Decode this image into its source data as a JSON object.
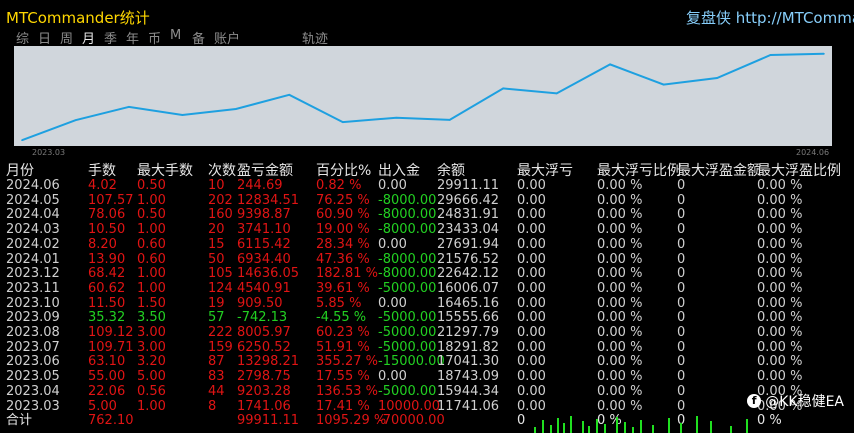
{
  "app": {
    "title": "MTCommander统计",
    "brand": "复盘侠 http://MTCommander"
  },
  "tabs": [
    {
      "label": "综",
      "active": false
    },
    {
      "label": "日",
      "active": false
    },
    {
      "label": "周",
      "active": false
    },
    {
      "label": "月",
      "active": true
    },
    {
      "label": "季",
      "active": false
    },
    {
      "label": "年",
      "active": false
    },
    {
      "label": "币",
      "active": false
    },
    {
      "label": "M",
      "active": false
    },
    {
      "label": "备",
      "active": false
    },
    {
      "label": "账户",
      "active": false
    },
    {
      "label": "轨迹",
      "active": false
    }
  ],
  "chart_data": {
    "type": "line",
    "x_start_label": "2023.03",
    "x_end_label": "2024.06",
    "series_color": "#1ea0e0",
    "grid": false,
    "x": [
      "2023.03",
      "2023.04",
      "2023.05",
      "2023.06",
      "2023.07",
      "2023.08",
      "2023.09",
      "2023.10",
      "2023.11",
      "2023.12",
      "2024.01",
      "2024.02",
      "2024.03",
      "2024.04",
      "2024.05",
      "2024.06"
    ],
    "values": [
      11741.06,
      15944.34,
      18743.09,
      17041.3,
      18291.82,
      21297.79,
      15555.66,
      16465.16,
      16006.07,
      22642.12,
      21576.52,
      27691.94,
      23433.04,
      24831.91,
      29666.42,
      29911.11
    ]
  },
  "table": {
    "headers": [
      "月份",
      "手数",
      "最大手数",
      "次数",
      "盈亏金额",
      "百分比%",
      "出入金",
      "余额",
      "最大浮亏",
      "最大浮亏比例",
      "最大浮盈金额",
      "最大浮盈比例"
    ],
    "colors": {
      "negative": "#e01414",
      "positive": "#22d022",
      "neutral": "#d0d0d0",
      "header": "#e6e6e6"
    },
    "rows": [
      {
        "month": "2024.06",
        "lots": "4.02",
        "maxlots": "0.50",
        "count": "10",
        "pnl": "244.69",
        "pct": "0.82 %",
        "flow": "0.00",
        "balance": "29911.11",
        "maxdd": "0.00",
        "maxddpct": "0.00 %",
        "maxfloat": "0",
        "maxfloatpct": "0.00 %",
        "sign": "negative"
      },
      {
        "month": "2024.05",
        "lots": "107.57",
        "maxlots": "1.00",
        "count": "202",
        "pnl": "12834.51",
        "pct": "76.25 %",
        "flow": "-8000.00",
        "balance": "29666.42",
        "maxdd": "0.00",
        "maxddpct": "0.00 %",
        "maxfloat": "0",
        "maxfloatpct": "0.00 %",
        "sign": "negative"
      },
      {
        "month": "2024.04",
        "lots": "78.06",
        "maxlots": "0.50",
        "count": "160",
        "pnl": "9398.87",
        "pct": "60.90 %",
        "flow": "-8000.00",
        "balance": "24831.91",
        "maxdd": "0.00",
        "maxddpct": "0.00 %",
        "maxfloat": "0",
        "maxfloatpct": "0.00 %",
        "sign": "negative"
      },
      {
        "month": "2024.03",
        "lots": "10.50",
        "maxlots": "1.00",
        "count": "20",
        "pnl": "3741.10",
        "pct": "19.00 %",
        "flow": "-8000.00",
        "balance": "23433.04",
        "maxdd": "0.00",
        "maxddpct": "0.00 %",
        "maxfloat": "0",
        "maxfloatpct": "0.00 %",
        "sign": "negative"
      },
      {
        "month": "2024.02",
        "lots": "8.20",
        "maxlots": "0.60",
        "count": "15",
        "pnl": "6115.42",
        "pct": "28.34 %",
        "flow": "0.00",
        "balance": "27691.94",
        "maxdd": "0.00",
        "maxddpct": "0.00 %",
        "maxfloat": "0",
        "maxfloatpct": "0.00 %",
        "sign": "negative"
      },
      {
        "month": "2024.01",
        "lots": "13.90",
        "maxlots": "0.60",
        "count": "50",
        "pnl": "6934.40",
        "pct": "47.36 %",
        "flow": "-8000.00",
        "balance": "21576.52",
        "maxdd": "0.00",
        "maxddpct": "0.00 %",
        "maxfloat": "0",
        "maxfloatpct": "0.00 %",
        "sign": "negative"
      },
      {
        "month": "2023.12",
        "lots": "68.42",
        "maxlots": "1.00",
        "count": "105",
        "pnl": "14636.05",
        "pct": "182.81 %",
        "flow": "-8000.00",
        "balance": "22642.12",
        "maxdd": "0.00",
        "maxddpct": "0.00 %",
        "maxfloat": "0",
        "maxfloatpct": "0.00 %",
        "sign": "negative"
      },
      {
        "month": "2023.11",
        "lots": "60.62",
        "maxlots": "1.00",
        "count": "124",
        "pnl": "4540.91",
        "pct": "39.61 %",
        "flow": "-5000.00",
        "balance": "16006.07",
        "maxdd": "0.00",
        "maxddpct": "0.00 %",
        "maxfloat": "0",
        "maxfloatpct": "0.00 %",
        "sign": "negative"
      },
      {
        "month": "2023.10",
        "lots": "11.50",
        "maxlots": "1.50",
        "count": "19",
        "pnl": "909.50",
        "pct": "5.85 %",
        "flow": "0.00",
        "balance": "16465.16",
        "maxdd": "0.00",
        "maxddpct": "0.00 %",
        "maxfloat": "0",
        "maxfloatpct": "0.00 %",
        "sign": "negative"
      },
      {
        "month": "2023.09",
        "lots": "35.32",
        "maxlots": "3.50",
        "count": "57",
        "pnl": "-742.13",
        "pct": "-4.55 %",
        "flow": "-5000.00",
        "balance": "15555.66",
        "maxdd": "0.00",
        "maxddpct": "0.00 %",
        "maxfloat": "0",
        "maxfloatpct": "0.00 %",
        "sign": "positive"
      },
      {
        "month": "2023.08",
        "lots": "109.12",
        "maxlots": "3.00",
        "count": "222",
        "pnl": "8005.97",
        "pct": "60.23 %",
        "flow": "-5000.00",
        "balance": "21297.79",
        "maxdd": "0.00",
        "maxddpct": "0.00 %",
        "maxfloat": "0",
        "maxfloatpct": "0.00 %",
        "sign": "negative"
      },
      {
        "month": "2023.07",
        "lots": "109.71",
        "maxlots": "3.00",
        "count": "159",
        "pnl": "6250.52",
        "pct": "51.91 %",
        "flow": "-5000.00",
        "balance": "18291.82",
        "maxdd": "0.00",
        "maxddpct": "0.00 %",
        "maxfloat": "0",
        "maxfloatpct": "0.00 %",
        "sign": "negative"
      },
      {
        "month": "2023.06",
        "lots": "63.10",
        "maxlots": "3.20",
        "count": "87",
        "pnl": "13298.21",
        "pct": "355.27 %",
        "flow": "-15000.00",
        "balance": "17041.30",
        "maxdd": "0.00",
        "maxddpct": "0.00 %",
        "maxfloat": "0",
        "maxfloatpct": "0.00 %",
        "sign": "negative"
      },
      {
        "month": "2023.05",
        "lots": "55.00",
        "maxlots": "5.00",
        "count": "83",
        "pnl": "2798.75",
        "pct": "17.55 %",
        "flow": "0.00",
        "balance": "18743.09",
        "maxdd": "0.00",
        "maxddpct": "0.00 %",
        "maxfloat": "0",
        "maxfloatpct": "0.00 %",
        "sign": "negative"
      },
      {
        "month": "2023.04",
        "lots": "22.06",
        "maxlots": "0.56",
        "count": "44",
        "pnl": "9203.28",
        "pct": "136.53 %",
        "flow": "-5000.00",
        "balance": "15944.34",
        "maxdd": "0.00",
        "maxddpct": "0.00 %",
        "maxfloat": "0",
        "maxfloatpct": "0.00 %",
        "sign": "negative"
      },
      {
        "month": "2023.03",
        "lots": "5.00",
        "maxlots": "1.00",
        "count": "8",
        "pnl": "1741.06",
        "pct": "17.41 %",
        "flow": "10000.00",
        "balance": "11741.06",
        "maxdd": "0.00",
        "maxddpct": "0.00 %",
        "maxfloat": "0",
        "maxfloatpct": "0.00 %",
        "sign": "negative"
      }
    ],
    "total": {
      "label": "合计",
      "lots": "762.10",
      "pnl": "99911.11",
      "pct": "1095.29 %",
      "flow": "-70000.00",
      "maxdd": "0",
      "maxddpct": "0 %",
      "maxfloat": "0",
      "maxfloatpct": "0 %"
    }
  },
  "watermark": {
    "text": "@KK稳健EA",
    "icon": "facebook-icon"
  }
}
